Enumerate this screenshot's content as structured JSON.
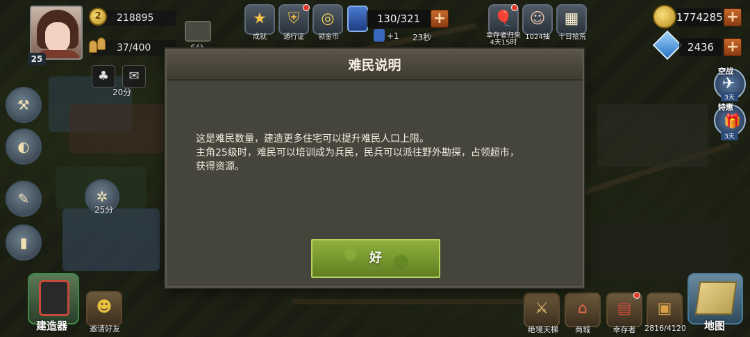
{
  "player": {
    "level": "25",
    "coins": "218895",
    "population": "37/400",
    "coin_icon_number": "2"
  },
  "top_bar": {
    "items": [
      {
        "label": "成就",
        "icon": "star-icon"
      },
      {
        "label": "通行证",
        "icon": "badge-icon"
      },
      {
        "label": "领金币",
        "icon": "coin-icon"
      }
    ],
    "energy_count": "130/321",
    "energy_timer_plus": "+1",
    "energy_timer": "23秒",
    "events": [
      {
        "label": "幸存者归来",
        "sub": "4天15时",
        "icon": "balloon-icon"
      },
      {
        "label": "1024抽",
        "sub": "",
        "icon": "girl-portrait-icon"
      },
      {
        "label": "十日拾荒",
        "sub": "",
        "icon": "calendar-icon"
      }
    ],
    "gold": "1774285",
    "diamonds": "2436"
  },
  "left_panel": {
    "timers": [
      "6分",
      "20分",
      "25分"
    ]
  },
  "right_panel": {
    "offers": [
      {
        "label": "空战",
        "days": "3天"
      },
      {
        "label": "特惠",
        "days": "3天"
      }
    ]
  },
  "bottom_bar": {
    "builder": "建造器",
    "invite": "邀请好友",
    "ladder": "绝境天梯",
    "shop": "商城",
    "survivors": "幸存者",
    "storage": "2816/4120",
    "map": "地图"
  },
  "modal": {
    "title": "难民说明",
    "line1": "这是难民数量，建造更多住宅可以提升难民人口上限。",
    "line2": "主角25级时，难民可以培训成为兵民，民兵可以派往野外勘探，占领超市，",
    "line3": "获得资源。",
    "ok_label": "好"
  }
}
